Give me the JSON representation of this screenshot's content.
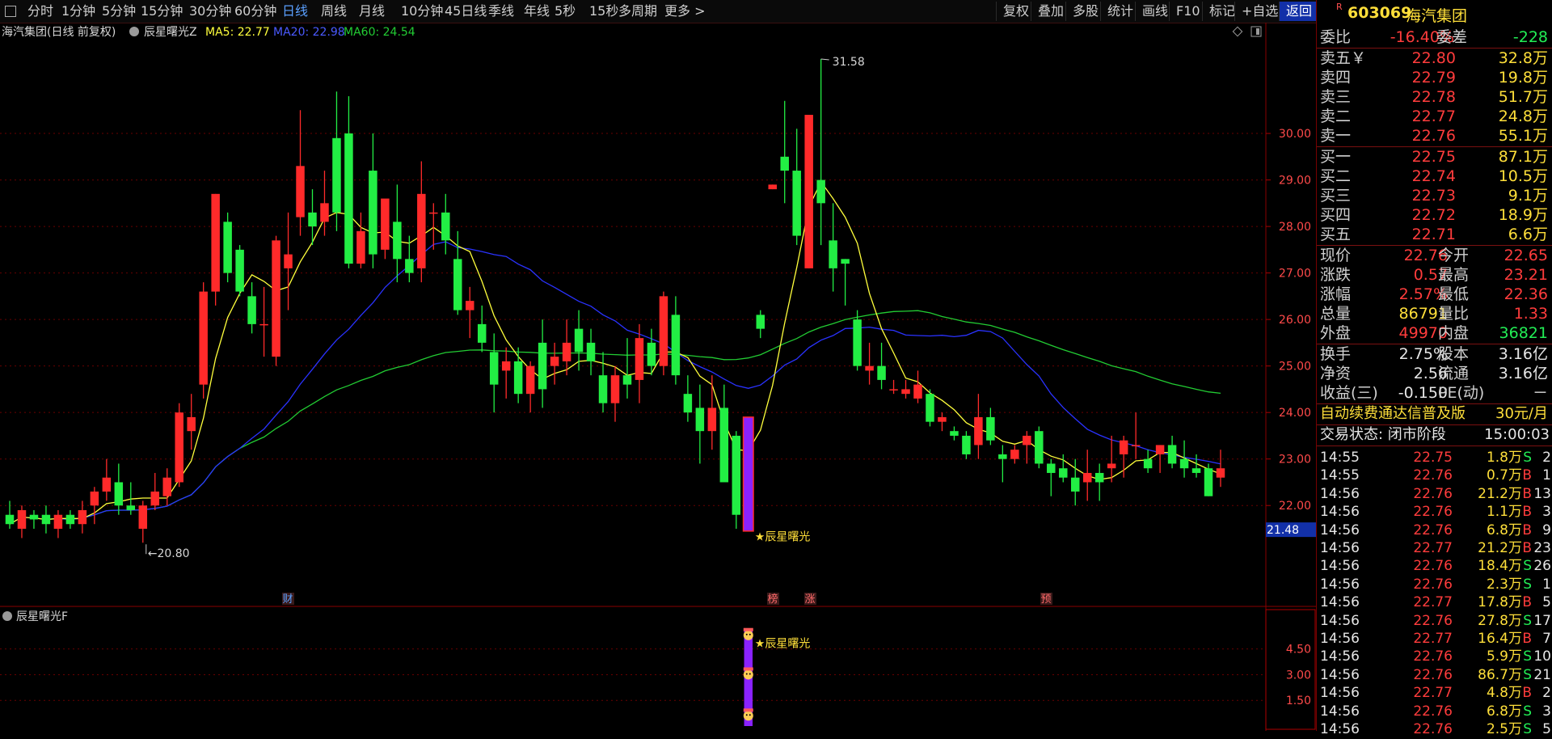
{
  "toolbar": {
    "periods": [
      "分时",
      "1分钟",
      "5分钟",
      "15分钟",
      "30分钟",
      "60分钟",
      "日线",
      "周线",
      "月线",
      "10分钟",
      "45日线",
      "季线",
      "年线",
      "5秒",
      "15秒",
      "多周期",
      "更多 >"
    ],
    "active": "日线",
    "right": [
      "复权",
      "叠加",
      "多股",
      "统计",
      "画线",
      "F10",
      "标记",
      "+自选",
      "返回"
    ]
  },
  "stock": {
    "code": "603069",
    "name": "海汽集团",
    "badge": "R"
  },
  "chart_header": {
    "title": "海汽集团(日线 前复权)",
    "indicator": "辰星曙光Z",
    "ma5": "MA5: 22.77",
    "ma20": "MA20: 22.98",
    "ma60": "MA60: 24.54"
  },
  "chart_data": [
    {
      "type": "candlestick",
      "title": "海汽集团(日线 前复权)",
      "yaxis_ticks": [
        "30.00",
        "29.00",
        "28.00",
        "27.00",
        "26.00",
        "25.00",
        "24.00",
        "23.00",
        "22.00"
      ],
      "ylim": [
        20.3,
        32.0
      ],
      "price_tag": "21.48",
      "annotations": {
        "high": "31.58",
        "low": "20.80",
        "signal": "★辰星曙光"
      },
      "event_markers": [
        "财",
        "榜",
        "涨",
        "预"
      ],
      "series": [
        {
          "name": "MA5",
          "color": "#ffff3c"
        },
        {
          "name": "MA20",
          "color": "#2a32ff"
        },
        {
          "name": "MA60",
          "color": "#22cc33"
        }
      ],
      "candles": [
        {
          "o": 21.8,
          "h": 22.1,
          "l": 21.5,
          "c": 21.6
        },
        {
          "o": 21.5,
          "h": 22.0,
          "l": 21.3,
          "c": 21.9
        },
        {
          "o": 21.8,
          "h": 21.9,
          "l": 21.5,
          "c": 21.7
        },
        {
          "o": 21.8,
          "h": 22.0,
          "l": 21.4,
          "c": 21.6
        },
        {
          "o": 21.5,
          "h": 21.9,
          "l": 21.3,
          "c": 21.8
        },
        {
          "o": 21.8,
          "h": 21.9,
          "l": 21.5,
          "c": 21.6
        },
        {
          "o": 21.6,
          "h": 22.1,
          "l": 21.4,
          "c": 21.9
        },
        {
          "o": 22.0,
          "h": 22.4,
          "l": 21.6,
          "c": 22.3
        },
        {
          "o": 22.3,
          "h": 23.0,
          "l": 22.1,
          "c": 22.6
        },
        {
          "o": 22.5,
          "h": 22.9,
          "l": 21.8,
          "c": 22.0
        },
        {
          "o": 22.0,
          "h": 22.5,
          "l": 21.8,
          "c": 21.9
        },
        {
          "o": 21.5,
          "h": 22.1,
          "l": 21.2,
          "c": 22.0
        },
        {
          "o": 22.0,
          "h": 22.7,
          "l": 21.9,
          "c": 22.3
        },
        {
          "o": 22.2,
          "h": 22.8,
          "l": 22.0,
          "c": 22.6
        },
        {
          "o": 22.5,
          "h": 24.2,
          "l": 22.4,
          "c": 24.0
        },
        {
          "o": 23.6,
          "h": 24.4,
          "l": 23.2,
          "c": 23.9
        },
        {
          "o": 24.6,
          "h": 26.8,
          "l": 24.3,
          "c": 26.6
        },
        {
          "o": 26.6,
          "h": 28.7,
          "l": 26.3,
          "c": 28.7
        },
        {
          "o": 28.1,
          "h": 28.3,
          "l": 26.8,
          "c": 27.0
        },
        {
          "o": 27.5,
          "h": 27.6,
          "l": 26.5,
          "c": 26.6
        },
        {
          "o": 26.5,
          "h": 26.8,
          "l": 25.7,
          "c": 25.9
        },
        {
          "o": 25.9,
          "h": 26.7,
          "l": 25.2,
          "c": 25.9
        },
        {
          "o": 25.2,
          "h": 27.8,
          "l": 25.0,
          "c": 27.7
        },
        {
          "o": 27.1,
          "h": 28.3,
          "l": 26.2,
          "c": 27.4
        },
        {
          "o": 28.2,
          "h": 30.5,
          "l": 27.8,
          "c": 29.3
        },
        {
          "o": 28.3,
          "h": 28.8,
          "l": 27.6,
          "c": 28.0
        },
        {
          "o": 28.1,
          "h": 29.2,
          "l": 27.8,
          "c": 28.5
        },
        {
          "o": 29.9,
          "h": 30.9,
          "l": 27.9,
          "c": 28.3
        },
        {
          "o": 30.0,
          "h": 30.8,
          "l": 27.1,
          "c": 27.2
        },
        {
          "o": 27.2,
          "h": 28.3,
          "l": 27.1,
          "c": 27.9
        },
        {
          "o": 29.2,
          "h": 30.0,
          "l": 27.1,
          "c": 27.4
        },
        {
          "o": 27.5,
          "h": 28.2,
          "l": 27.3,
          "c": 28.6
        },
        {
          "o": 28.1,
          "h": 28.9,
          "l": 26.8,
          "c": 27.3
        },
        {
          "o": 27.3,
          "h": 27.8,
          "l": 26.8,
          "c": 27.0
        },
        {
          "o": 27.1,
          "h": 29.4,
          "l": 26.8,
          "c": 28.7
        },
        {
          "o": 28.3,
          "h": 28.5,
          "l": 27.5,
          "c": 28.3
        },
        {
          "o": 28.3,
          "h": 28.7,
          "l": 27.4,
          "c": 27.7
        },
        {
          "o": 27.3,
          "h": 27.9,
          "l": 26.1,
          "c": 26.2
        },
        {
          "o": 26.2,
          "h": 26.7,
          "l": 25.6,
          "c": 26.4
        },
        {
          "o": 25.9,
          "h": 26.3,
          "l": 25.3,
          "c": 25.5
        },
        {
          "o": 25.3,
          "h": 25.7,
          "l": 24.0,
          "c": 24.6
        },
        {
          "o": 24.9,
          "h": 25.4,
          "l": 24.3,
          "c": 25.1
        },
        {
          "o": 25.1,
          "h": 25.4,
          "l": 24.2,
          "c": 24.4
        },
        {
          "o": 24.4,
          "h": 25.1,
          "l": 24.0,
          "c": 25.0
        },
        {
          "o": 25.5,
          "h": 26.0,
          "l": 24.1,
          "c": 24.5
        },
        {
          "o": 25.0,
          "h": 25.5,
          "l": 24.6,
          "c": 25.2
        },
        {
          "o": 25.1,
          "h": 26.0,
          "l": 24.8,
          "c": 25.5
        },
        {
          "o": 25.8,
          "h": 26.2,
          "l": 24.9,
          "c": 25.3
        },
        {
          "o": 25.5,
          "h": 25.8,
          "l": 24.8,
          "c": 25.1
        },
        {
          "o": 24.8,
          "h": 25.3,
          "l": 24.0,
          "c": 24.2
        },
        {
          "o": 24.2,
          "h": 25.0,
          "l": 23.8,
          "c": 24.8
        },
        {
          "o": 24.8,
          "h": 25.6,
          "l": 24.3,
          "c": 24.6
        },
        {
          "o": 24.7,
          "h": 25.9,
          "l": 24.2,
          "c": 25.6
        },
        {
          "o": 25.5,
          "h": 25.8,
          "l": 24.8,
          "c": 25.0
        },
        {
          "o": 25.0,
          "h": 26.6,
          "l": 24.8,
          "c": 26.5
        },
        {
          "o": 26.1,
          "h": 26.5,
          "l": 24.6,
          "c": 24.8
        },
        {
          "o": 24.4,
          "h": 24.8,
          "l": 23.8,
          "c": 24.0
        },
        {
          "o": 24.1,
          "h": 24.6,
          "l": 22.9,
          "c": 23.6
        },
        {
          "o": 23.6,
          "h": 24.8,
          "l": 23.2,
          "c": 24.1
        },
        {
          "o": 24.1,
          "h": 24.6,
          "l": 23.0,
          "c": 22.5
        },
        {
          "o": 23.5,
          "h": 23.6,
          "l": 21.5,
          "c": 21.8
        },
        {
          "o": 21.5,
          "h": 23.9,
          "l": 21.5,
          "c": 23.9
        },
        {
          "o": 26.1,
          "h": 26.2,
          "l": 25.6,
          "c": 25.8
        },
        {
          "o": 28.8,
          "h": 28.9,
          "l": 28.8,
          "c": 28.9
        },
        {
          "o": 29.5,
          "h": 30.7,
          "l": 28.5,
          "c": 29.2
        },
        {
          "o": 29.2,
          "h": 30.1,
          "l": 27.6,
          "c": 27.8
        },
        {
          "o": 27.1,
          "h": 30.4,
          "l": 27.1,
          "c": 30.4
        },
        {
          "o": 29.0,
          "h": 31.6,
          "l": 27.6,
          "c": 28.5
        },
        {
          "o": 27.7,
          "h": 28.5,
          "l": 26.6,
          "c": 27.1
        },
        {
          "o": 27.3,
          "h": 27.3,
          "l": 26.3,
          "c": 27.2
        },
        {
          "o": 26.0,
          "h": 26.2,
          "l": 24.9,
          "c": 25.0
        },
        {
          "o": 24.9,
          "h": 25.5,
          "l": 24.6,
          "c": 25.0
        },
        {
          "o": 25.0,
          "h": 25.5,
          "l": 24.5,
          "c": 24.7
        },
        {
          "o": 24.5,
          "h": 24.7,
          "l": 24.4,
          "c": 24.5
        },
        {
          "o": 24.4,
          "h": 24.7,
          "l": 24.3,
          "c": 24.5
        },
        {
          "o": 24.3,
          "h": 24.9,
          "l": 24.2,
          "c": 24.6
        },
        {
          "o": 24.4,
          "h": 24.5,
          "l": 23.7,
          "c": 23.8
        },
        {
          "o": 23.8,
          "h": 24.0,
          "l": 23.6,
          "c": 23.9
        },
        {
          "o": 23.6,
          "h": 23.7,
          "l": 23.4,
          "c": 23.5
        },
        {
          "o": 23.5,
          "h": 23.6,
          "l": 23.0,
          "c": 23.1
        },
        {
          "o": 23.3,
          "h": 24.4,
          "l": 23.0,
          "c": 23.9
        },
        {
          "o": 23.9,
          "h": 24.1,
          "l": 23.3,
          "c": 23.4
        },
        {
          "o": 23.1,
          "h": 23.3,
          "l": 22.5,
          "c": 23.0
        },
        {
          "o": 23.0,
          "h": 23.3,
          "l": 22.9,
          "c": 23.2
        },
        {
          "o": 23.3,
          "h": 23.6,
          "l": 22.9,
          "c": 23.5
        },
        {
          "o": 23.6,
          "h": 23.7,
          "l": 22.8,
          "c": 22.9
        },
        {
          "o": 22.9,
          "h": 23.0,
          "l": 22.2,
          "c": 22.7
        },
        {
          "o": 22.8,
          "h": 23.1,
          "l": 22.5,
          "c": 22.6
        },
        {
          "o": 22.6,
          "h": 23.0,
          "l": 22.0,
          "c": 22.3
        },
        {
          "o": 22.5,
          "h": 23.2,
          "l": 22.1,
          "c": 22.7
        },
        {
          "o": 22.7,
          "h": 22.9,
          "l": 22.1,
          "c": 22.5
        },
        {
          "o": 22.8,
          "h": 23.5,
          "l": 22.5,
          "c": 22.9
        },
        {
          "o": 23.1,
          "h": 23.5,
          "l": 22.6,
          "c": 23.4
        },
        {
          "o": 23.3,
          "h": 24.0,
          "l": 23.0,
          "c": 23.3
        },
        {
          "o": 23.0,
          "h": 23.2,
          "l": 22.7,
          "c": 22.8
        },
        {
          "o": 23.1,
          "h": 23.3,
          "l": 22.7,
          "c": 23.3
        },
        {
          "o": 23.3,
          "h": 23.5,
          "l": 22.8,
          "c": 22.9
        },
        {
          "o": 23.0,
          "h": 23.4,
          "l": 22.6,
          "c": 22.8
        },
        {
          "o": 22.8,
          "h": 23.1,
          "l": 22.6,
          "c": 22.7
        },
        {
          "o": 22.8,
          "h": 22.9,
          "l": 22.2,
          "c": 22.2
        },
        {
          "o": 22.6,
          "h": 23.2,
          "l": 22.4,
          "c": 22.8
        }
      ]
    },
    {
      "type": "bar",
      "title": "辰星曙光F",
      "yaxis_ticks": [
        "4.50",
        "3.00",
        "1.50"
      ],
      "ylim": [
        0,
        5.9
      ],
      "values": [
        5.6
      ],
      "signal_label": "★辰星曙光"
    }
  ],
  "quote": {
    "wei_bi": {
      "label": "委比",
      "value": "-16.40%"
    },
    "wei_cha": {
      "label": "委差",
      "value": "-228"
    },
    "sell": [
      {
        "label": "卖五￥",
        "price": "22.80",
        "vol": "32.8万"
      },
      {
        "label": "卖四",
        "price": "22.79",
        "vol": "19.8万"
      },
      {
        "label": "卖三",
        "price": "22.78",
        "vol": "51.7万"
      },
      {
        "label": "卖二",
        "price": "22.77",
        "vol": "24.8万"
      },
      {
        "label": "卖一",
        "price": "22.76",
        "vol": "55.1万"
      }
    ],
    "buy": [
      {
        "label": "买一",
        "price": "22.75",
        "vol": "87.1万"
      },
      {
        "label": "买二",
        "price": "22.74",
        "vol": "10.5万"
      },
      {
        "label": "买三",
        "price": "22.73",
        "vol": "9.1万"
      },
      {
        "label": "买四",
        "price": "22.72",
        "vol": "18.9万"
      },
      {
        "label": "买五",
        "price": "22.71",
        "vol": "6.6万"
      }
    ],
    "stats1": [
      {
        "l1": "现价",
        "v1": "22.76",
        "c1": "red",
        "l2": "今开",
        "v2": "22.65",
        "c2": "red"
      },
      {
        "l1": "涨跌",
        "v1": "0.57",
        "c1": "red",
        "l2": "最高",
        "v2": "23.21",
        "c2": "red"
      },
      {
        "l1": "涨幅",
        "v1": "2.57%",
        "c1": "red",
        "l2": "最低",
        "v2": "22.36",
        "c2": "red"
      },
      {
        "l1": "总量",
        "v1": "86791",
        "c1": "yellow",
        "l2": "量比",
        "v2": "1.33",
        "c2": "red"
      },
      {
        "l1": "外盘",
        "v1": "49970",
        "c1": "red",
        "l2": "内盘",
        "v2": "36821",
        "c2": "green"
      }
    ],
    "stats2": [
      {
        "l1": "换手",
        "v1": "2.75%",
        "c1": "white",
        "l2": "股本",
        "v2": "3.16亿",
        "c2": "white"
      },
      {
        "l1": "净资",
        "v1": "2.56",
        "c1": "white",
        "l2": "流通",
        "v2": "3.16亿",
        "c2": "white"
      },
      {
        "l1": "收益(三)",
        "v1": "-0.150",
        "c1": "white",
        "l2": "PE(动)",
        "v2": "－",
        "c2": "white"
      }
    ],
    "ad_text": "自动续费通达信普及版",
    "ad_price": "30元/月",
    "trade_status": "交易状态: 闭市阶段",
    "trade_time": "15:00:03"
  },
  "ticks": [
    {
      "t": "14:55",
      "p": "22.75",
      "v": "1.8万",
      "d": "S",
      "n": "2"
    },
    {
      "t": "14:55",
      "p": "22.76",
      "v": "0.7万",
      "d": "B",
      "n": "1"
    },
    {
      "t": "14:56",
      "p": "22.76",
      "v": "21.2万",
      "d": "B",
      "n": "13"
    },
    {
      "t": "14:56",
      "p": "22.76",
      "v": "1.1万",
      "d": "B",
      "n": "3"
    },
    {
      "t": "14:56",
      "p": "22.76",
      "v": "6.8万",
      "d": "B",
      "n": "9"
    },
    {
      "t": "14:56",
      "p": "22.77",
      "v": "21.2万",
      "d": "B",
      "n": "23"
    },
    {
      "t": "14:56",
      "p": "22.76",
      "v": "18.4万",
      "d": "S",
      "n": "26"
    },
    {
      "t": "14:56",
      "p": "22.76",
      "v": "2.3万",
      "d": "S",
      "n": "1"
    },
    {
      "t": "14:56",
      "p": "22.77",
      "v": "17.8万",
      "d": "B",
      "n": "5"
    },
    {
      "t": "14:56",
      "p": "22.76",
      "v": "27.8万",
      "d": "S",
      "n": "17"
    },
    {
      "t": "14:56",
      "p": "22.77",
      "v": "16.4万",
      "d": "B",
      "n": "7"
    },
    {
      "t": "14:56",
      "p": "22.76",
      "v": "5.9万",
      "d": "S",
      "n": "10"
    },
    {
      "t": "14:56",
      "p": "22.76",
      "v": "86.7万",
      "d": "S",
      "n": "21"
    },
    {
      "t": "14:56",
      "p": "22.77",
      "v": "4.8万",
      "d": "B",
      "n": "2"
    },
    {
      "t": "14:56",
      "p": "22.76",
      "v": "6.8万",
      "d": "S",
      "n": "3"
    },
    {
      "t": "14:56",
      "p": "22.76",
      "v": "2.5万",
      "d": "S",
      "n": "5"
    }
  ],
  "colors": {
    "up": "#ff2a2a",
    "down": "#22ee44",
    "grid": "#6a0000",
    "ma5": "#ffff3c",
    "ma20": "#2a32ff",
    "ma60": "#22cc33"
  }
}
